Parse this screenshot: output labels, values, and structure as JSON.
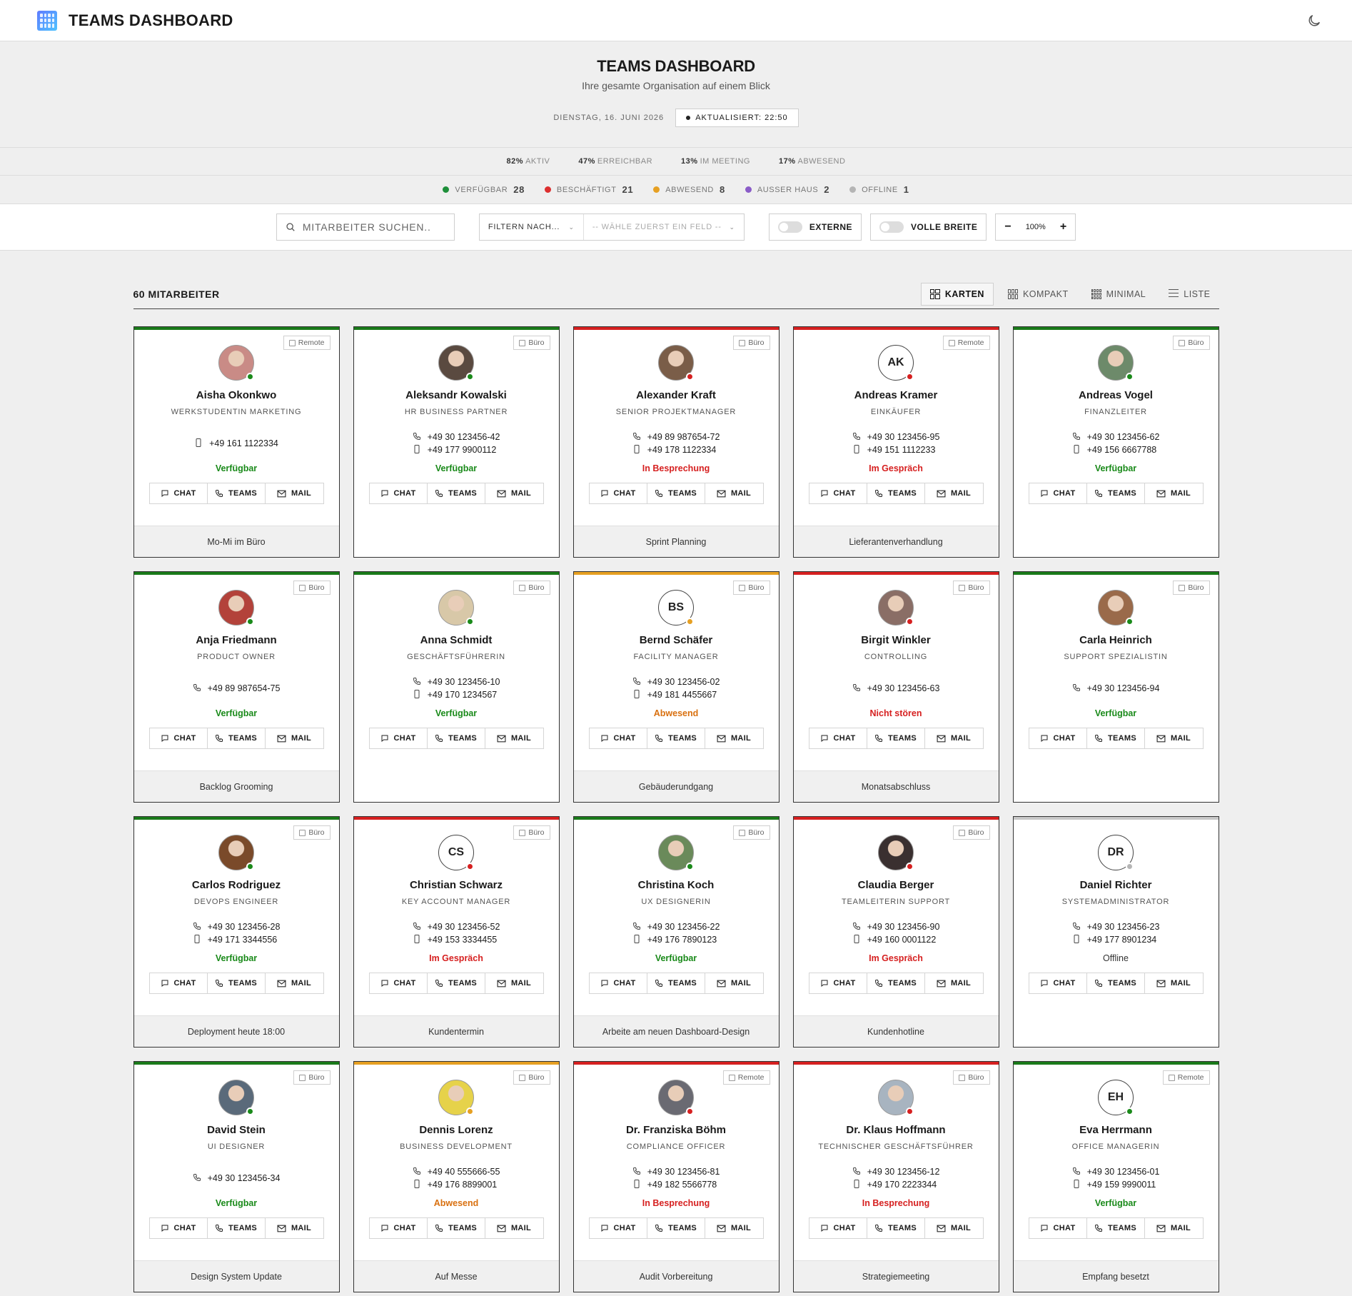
{
  "app": {
    "title": "TEAMS DASHBOARD"
  },
  "header": {
    "title": "TEAMS DASHBOARD",
    "subtitle": "Ihre gesamte Organisation auf einem Blick",
    "date": "DIENSTAG, 16. JUNI 2026",
    "updated": "AKTUALISIERT: 22:50"
  },
  "metrics": [
    {
      "value": "82%",
      "label": "AKTIV"
    },
    {
      "value": "47%",
      "label": "ERREICHBAR"
    },
    {
      "value": "13%",
      "label": "IM MEETING"
    },
    {
      "value": "17%",
      "label": "ABWESEND"
    }
  ],
  "status_counts": [
    {
      "label": "VERFÜGBAR",
      "count": "28",
      "color": "#1e8f3a"
    },
    {
      "label": "BESCHÄFTIGT",
      "count": "21",
      "color": "#dc2f2f"
    },
    {
      "label": "ABWESEND",
      "count": "8",
      "color": "#e6a023"
    },
    {
      "label": "AUSSER HAUS",
      "count": "2",
      "color": "#8a5cc8"
    },
    {
      "label": "OFFLINE",
      "count": "1",
      "color": "#b5b5b5"
    }
  ],
  "toolbar": {
    "search_placeholder": "MITARBEITER SUCHEN...",
    "filter_label": "FILTERN NACH...",
    "filter_value_placeholder": "-- WÄHLE ZUERST EIN FELD --",
    "externe_label": "EXTERNE",
    "full_width_label": "VOLLE BREITE",
    "zoom": "100%"
  },
  "list": {
    "count_label": "60 MITARBEITER",
    "views": [
      {
        "label": "KARTEN",
        "active": true
      },
      {
        "label": "KOMPAKT",
        "active": false
      },
      {
        "label": "MINIMAL",
        "active": false
      },
      {
        "label": "LISTE",
        "active": false
      }
    ]
  },
  "actions": {
    "chat": "CHAT",
    "teams": "TEAMS",
    "mail": "MAIL"
  },
  "employees": [
    {
      "name": "Aisha Okonkwo",
      "role": "WERKSTUDENTIN MARKETING",
      "location": "Remote",
      "phones": [
        {
          "type": "mobile",
          "number": "+49 161 1122334"
        }
      ],
      "status": "Verfügbar",
      "status_color": "#1a8a1a",
      "bar_color": "#1a7a1a",
      "dot_color": "#1a8a1a",
      "initials": "",
      "photo_bg": "#c98b86",
      "note": "Mo-Mi im Büro"
    },
    {
      "name": "Aleksandr Kowalski",
      "role": "HR BUSINESS PARTNER",
      "location": "Büro",
      "phones": [
        {
          "type": "phone",
          "number": "+49 30 123456-42"
        },
        {
          "type": "mobile",
          "number": "+49 177 9900112"
        }
      ],
      "status": "Verfügbar",
      "status_color": "#1a8a1a",
      "bar_color": "#1a7a1a",
      "dot_color": "#1a8a1a",
      "initials": "",
      "photo_bg": "#5a4a40",
      "note": ""
    },
    {
      "name": "Alexander Kraft",
      "role": "SENIOR PROJEKTMANAGER",
      "location": "Büro",
      "phones": [
        {
          "type": "phone",
          "number": "+49 89 987654-72"
        },
        {
          "type": "mobile",
          "number": "+49 178 1122334"
        }
      ],
      "status": "In Besprechung",
      "status_color": "#d62020",
      "bar_color": "#d62020",
      "dot_color": "#d62020",
      "initials": "",
      "photo_bg": "#7a5d48",
      "note": "Sprint Planning"
    },
    {
      "name": "Andreas Kramer",
      "role": "EINKÄUFER",
      "location": "Remote",
      "phones": [
        {
          "type": "phone",
          "number": "+49 30 123456-95"
        },
        {
          "type": "mobile",
          "number": "+49 151 1112233"
        }
      ],
      "status": "Im Gespräch",
      "status_color": "#d62020",
      "bar_color": "#d62020",
      "dot_color": "#d62020",
      "initials": "AK",
      "photo_bg": "",
      "note": "Lieferantenverhandlung"
    },
    {
      "name": "Andreas Vogel",
      "role": "FINANZLEITER",
      "location": "Büro",
      "phones": [
        {
          "type": "phone",
          "number": "+49 30 123456-62"
        },
        {
          "type": "mobile",
          "number": "+49 156 6667788"
        }
      ],
      "status": "Verfügbar",
      "status_color": "#1a8a1a",
      "bar_color": "#1a7a1a",
      "dot_color": "#1a8a1a",
      "initials": "",
      "photo_bg": "#6d8a6a",
      "note": ""
    },
    {
      "name": "Anja Friedmann",
      "role": "PRODUCT OWNER",
      "location": "Büro",
      "phones": [
        {
          "type": "phone",
          "number": "+49 89 987654-75"
        }
      ],
      "status": "Verfügbar",
      "status_color": "#1a8a1a",
      "bar_color": "#1a7a1a",
      "dot_color": "#1a8a1a",
      "initials": "",
      "photo_bg": "#b3423a",
      "note": "Backlog Grooming"
    },
    {
      "name": "Anna Schmidt",
      "role": "GESCHÄFTSFÜHRERIN",
      "location": "Büro",
      "phones": [
        {
          "type": "phone",
          "number": "+49 30 123456-10"
        },
        {
          "type": "mobile",
          "number": "+49 170 1234567"
        }
      ],
      "status": "Verfügbar",
      "status_color": "#1a8a1a",
      "bar_color": "#1a7a1a",
      "dot_color": "#1a8a1a",
      "initials": "",
      "photo_bg": "#d8c8a8",
      "note": ""
    },
    {
      "name": "Bernd Schäfer",
      "role": "FACILITY MANAGER",
      "location": "Büro",
      "phones": [
        {
          "type": "phone",
          "number": "+49 30 123456-02"
        },
        {
          "type": "mobile",
          "number": "+49 181 4455667"
        }
      ],
      "status": "Abwesend",
      "status_color": "#d9700f",
      "bar_color": "#e6a023",
      "dot_color": "#e6a023",
      "initials": "BS",
      "photo_bg": "",
      "note": "Gebäuderundgang"
    },
    {
      "name": "Birgit Winkler",
      "role": "CONTROLLING",
      "location": "Büro",
      "phones": [
        {
          "type": "phone",
          "number": "+49 30 123456-63"
        }
      ],
      "status": "Nicht stören",
      "status_color": "#d62020",
      "bar_color": "#d62020",
      "dot_color": "#d62020",
      "initials": "",
      "photo_bg": "#8a6e66",
      "note": "Monatsabschluss"
    },
    {
      "name": "Carla Heinrich",
      "role": "SUPPORT SPEZIALISTIN",
      "location": "Büro",
      "phones": [
        {
          "type": "phone",
          "number": "+49 30 123456-94"
        }
      ],
      "status": "Verfügbar",
      "status_color": "#1a8a1a",
      "bar_color": "#1a7a1a",
      "dot_color": "#1a8a1a",
      "initials": "",
      "photo_bg": "#9a6a4a",
      "note": ""
    },
    {
      "name": "Carlos Rodriguez",
      "role": "DEVOPS ENGINEER",
      "location": "Büro",
      "phones": [
        {
          "type": "phone",
          "number": "+49 30 123456-28"
        },
        {
          "type": "mobile",
          "number": "+49 171 3344556"
        }
      ],
      "status": "Verfügbar",
      "status_color": "#1a8a1a",
      "bar_color": "#1a7a1a",
      "dot_color": "#1a8a1a",
      "initials": "",
      "photo_bg": "#7a4a2a",
      "note": "Deployment heute 18:00"
    },
    {
      "name": "Christian Schwarz",
      "role": "KEY ACCOUNT MANAGER",
      "location": "Büro",
      "phones": [
        {
          "type": "phone",
          "number": "+49 30 123456-52"
        },
        {
          "type": "mobile",
          "number": "+49 153 3334455"
        }
      ],
      "status": "Im Gespräch",
      "status_color": "#d62020",
      "bar_color": "#d62020",
      "dot_color": "#d62020",
      "initials": "CS",
      "photo_bg": "",
      "note": "Kundentermin"
    },
    {
      "name": "Christina Koch",
      "role": "UX DESIGNERIN",
      "location": "Büro",
      "phones": [
        {
          "type": "phone",
          "number": "+49 30 123456-22"
        },
        {
          "type": "mobile",
          "number": "+49 176 7890123"
        }
      ],
      "status": "Verfügbar",
      "status_color": "#1a8a1a",
      "bar_color": "#1a7a1a",
      "dot_color": "#1a8a1a",
      "initials": "",
      "photo_bg": "#6a8a5a",
      "note": "Arbeite am neuen Dashboard-Design"
    },
    {
      "name": "Claudia Berger",
      "role": "TEAMLEITERIN SUPPORT",
      "location": "Büro",
      "phones": [
        {
          "type": "phone",
          "number": "+49 30 123456-90"
        },
        {
          "type": "mobile",
          "number": "+49 160 0001122"
        }
      ],
      "status": "Im Gespräch",
      "status_color": "#d62020",
      "bar_color": "#d62020",
      "dot_color": "#d62020",
      "initials": "",
      "photo_bg": "#3a3030",
      "note": "Kundenhotline"
    },
    {
      "name": "Daniel Richter",
      "role": "SYSTEMADMINISTRATOR",
      "location": "",
      "phones": [
        {
          "type": "phone",
          "number": "+49 30 123456-23"
        },
        {
          "type": "mobile",
          "number": "+49 177 8901234"
        }
      ],
      "status": "Offline",
      "status_color": "#333333",
      "bar_color": "#c8c8c8",
      "dot_color": "#b5b5b5",
      "initials": "DR",
      "photo_bg": "",
      "note": ""
    },
    {
      "name": "David Stein",
      "role": "UI DESIGNER",
      "location": "Büro",
      "phones": [
        {
          "type": "phone",
          "number": "+49 30 123456-34"
        }
      ],
      "status": "Verfügbar",
      "status_color": "#1a8a1a",
      "bar_color": "#1a7a1a",
      "dot_color": "#1a8a1a",
      "initials": "",
      "photo_bg": "#5a6a7a",
      "note": "Design System Update"
    },
    {
      "name": "Dennis Lorenz",
      "role": "BUSINESS DEVELOPMENT",
      "location": "Büro",
      "phones": [
        {
          "type": "phone",
          "number": "+49 40 555666-55"
        },
        {
          "type": "mobile",
          "number": "+49 176 8899001"
        }
      ],
      "status": "Abwesend",
      "status_color": "#d9700f",
      "bar_color": "#e6a023",
      "dot_color": "#e6a023",
      "initials": "",
      "photo_bg": "#e6d24a",
      "note": "Auf Messe"
    },
    {
      "name": "Dr. Franziska Böhm",
      "role": "COMPLIANCE OFFICER",
      "location": "Remote",
      "phones": [
        {
          "type": "phone",
          "number": "+49 30 123456-81"
        },
        {
          "type": "mobile",
          "number": "+49 182 5566778"
        }
      ],
      "status": "In Besprechung",
      "status_color": "#d62020",
      "bar_color": "#d62020",
      "dot_color": "#d62020",
      "initials": "",
      "photo_bg": "#6a6a72",
      "note": "Audit Vorbereitung"
    },
    {
      "name": "Dr. Klaus Hoffmann",
      "role": "TECHNISCHER GESCHÄFTSFÜHRER",
      "location": "Büro",
      "phones": [
        {
          "type": "phone",
          "number": "+49 30 123456-12"
        },
        {
          "type": "mobile",
          "number": "+49 170 2223344"
        }
      ],
      "status": "In Besprechung",
      "status_color": "#d62020",
      "bar_color": "#d62020",
      "dot_color": "#d62020",
      "initials": "",
      "photo_bg": "#a8b4c0",
      "note": "Strategiemeeting"
    },
    {
      "name": "Eva Herrmann",
      "role": "OFFICE MANAGERIN",
      "location": "Remote",
      "phones": [
        {
          "type": "phone",
          "number": "+49 30 123456-01"
        },
        {
          "type": "mobile",
          "number": "+49 159 9990011"
        }
      ],
      "status": "Verfügbar",
      "status_color": "#1a8a1a",
      "bar_color": "#1a7a1a",
      "dot_color": "#1a8a1a",
      "initials": "EH",
      "photo_bg": "",
      "note": "Empfang besetzt"
    }
  ]
}
